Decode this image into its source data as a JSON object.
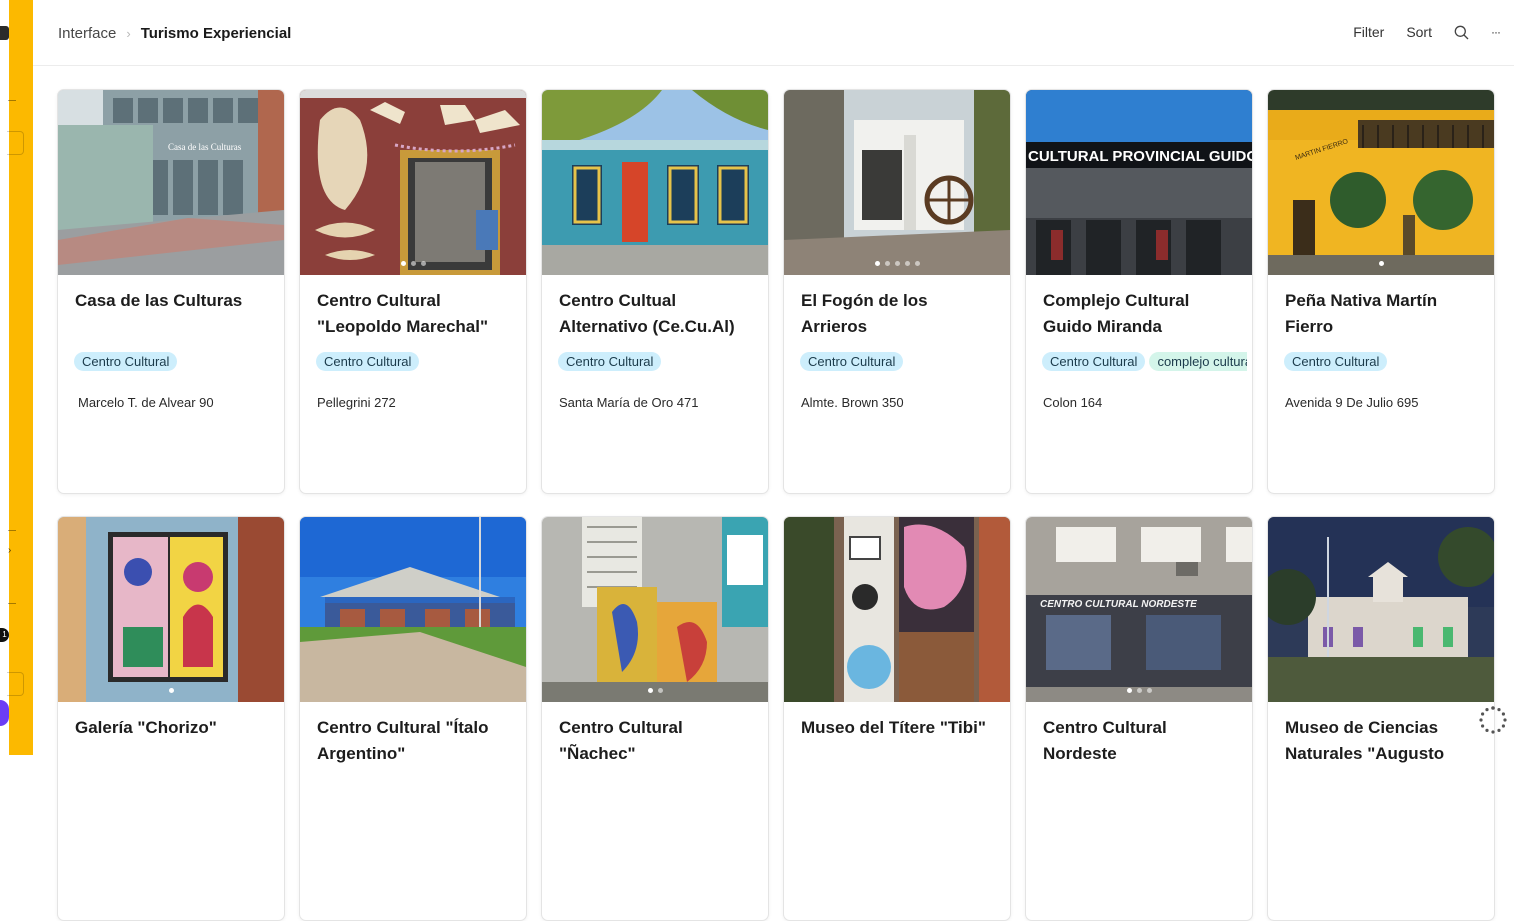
{
  "breadcrumb": {
    "parent": "Interface",
    "current": "Turismo Experiencial"
  },
  "toolbar": {
    "filter_label": "Filter",
    "sort_label": "Sort",
    "more_label": "···"
  },
  "sidebar": {
    "badge_count": "1"
  },
  "colors": {
    "accent": "#fcb900",
    "tag_blue": "#cdeefc",
    "tag_green": "#d4f5ea"
  },
  "cards": [
    {
      "title": "Casa de las Culturas",
      "tags": [
        "Centro Cultural"
      ],
      "address": "Marcelo T. de Alvear 90",
      "image_label": "Casa de las Culturas"
    },
    {
      "title": "Centro Cultural \"Leopoldo Marechal\"",
      "tags": [
        "Centro Cultural"
      ],
      "address": "Pellegrini 272"
    },
    {
      "title": "Centro Cultual Alternativo (Ce.Cu.Al)",
      "tags": [
        "Centro Cultural"
      ],
      "address": "Santa María de Oro 471"
    },
    {
      "title": "El Fogón de los Arrieros",
      "tags": [
        "Centro Cultural"
      ],
      "address": "Almte. Brown 350"
    },
    {
      "title": "Complejo Cultural Guido Miranda",
      "tags": [
        "Centro Cultural",
        "complejo cultural"
      ],
      "address": "Colon 164",
      "image_label": "CULTURAL PROVINCIAL GUIDO MIRAND"
    },
    {
      "title": "Peña Nativa Martín Fierro",
      "tags": [
        "Centro Cultural"
      ],
      "address": "Avenida 9 De Julio 695",
      "image_label": "MARTIN FIERRO"
    },
    {
      "title": "Galería \"Chorizo\"",
      "tags": [],
      "address": ""
    },
    {
      "title": "Centro Cultural \"Ítalo Argentino\"",
      "tags": [],
      "address": ""
    },
    {
      "title": "Centro Cultural \"Ñachec\"",
      "tags": [],
      "address": ""
    },
    {
      "title": "Museo del Títere \"Tibi\"",
      "tags": [],
      "address": ""
    },
    {
      "title": "Centro Cultural Nordeste",
      "tags": [],
      "address": "",
      "image_label": "CENTRO CULTURAL NORDESTE"
    },
    {
      "title": "Museo de Ciencias Naturales \"Augusto",
      "tags": [],
      "address": ""
    }
  ]
}
